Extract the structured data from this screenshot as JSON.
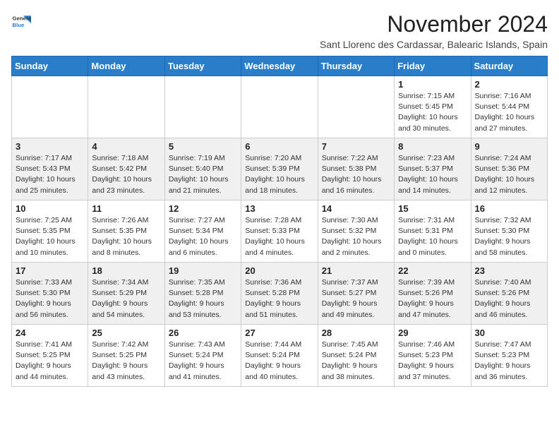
{
  "header": {
    "logo_line1": "General",
    "logo_line2": "Blue",
    "month": "November 2024",
    "location": "Sant Llorenc des Cardassar, Balearic Islands, Spain"
  },
  "days_of_week": [
    "Sunday",
    "Monday",
    "Tuesday",
    "Wednesday",
    "Thursday",
    "Friday",
    "Saturday"
  ],
  "weeks": [
    [
      {
        "num": "",
        "info": ""
      },
      {
        "num": "",
        "info": ""
      },
      {
        "num": "",
        "info": ""
      },
      {
        "num": "",
        "info": ""
      },
      {
        "num": "",
        "info": ""
      },
      {
        "num": "1",
        "info": "Sunrise: 7:15 AM\nSunset: 5:45 PM\nDaylight: 10 hours and 30 minutes."
      },
      {
        "num": "2",
        "info": "Sunrise: 7:16 AM\nSunset: 5:44 PM\nDaylight: 10 hours and 27 minutes."
      }
    ],
    [
      {
        "num": "3",
        "info": "Sunrise: 7:17 AM\nSunset: 5:43 PM\nDaylight: 10 hours and 25 minutes."
      },
      {
        "num": "4",
        "info": "Sunrise: 7:18 AM\nSunset: 5:42 PM\nDaylight: 10 hours and 23 minutes."
      },
      {
        "num": "5",
        "info": "Sunrise: 7:19 AM\nSunset: 5:40 PM\nDaylight: 10 hours and 21 minutes."
      },
      {
        "num": "6",
        "info": "Sunrise: 7:20 AM\nSunset: 5:39 PM\nDaylight: 10 hours and 18 minutes."
      },
      {
        "num": "7",
        "info": "Sunrise: 7:22 AM\nSunset: 5:38 PM\nDaylight: 10 hours and 16 minutes."
      },
      {
        "num": "8",
        "info": "Sunrise: 7:23 AM\nSunset: 5:37 PM\nDaylight: 10 hours and 14 minutes."
      },
      {
        "num": "9",
        "info": "Sunrise: 7:24 AM\nSunset: 5:36 PM\nDaylight: 10 hours and 12 minutes."
      }
    ],
    [
      {
        "num": "10",
        "info": "Sunrise: 7:25 AM\nSunset: 5:35 PM\nDaylight: 10 hours and 10 minutes."
      },
      {
        "num": "11",
        "info": "Sunrise: 7:26 AM\nSunset: 5:35 PM\nDaylight: 10 hours and 8 minutes."
      },
      {
        "num": "12",
        "info": "Sunrise: 7:27 AM\nSunset: 5:34 PM\nDaylight: 10 hours and 6 minutes."
      },
      {
        "num": "13",
        "info": "Sunrise: 7:28 AM\nSunset: 5:33 PM\nDaylight: 10 hours and 4 minutes."
      },
      {
        "num": "14",
        "info": "Sunrise: 7:30 AM\nSunset: 5:32 PM\nDaylight: 10 hours and 2 minutes."
      },
      {
        "num": "15",
        "info": "Sunrise: 7:31 AM\nSunset: 5:31 PM\nDaylight: 10 hours and 0 minutes."
      },
      {
        "num": "16",
        "info": "Sunrise: 7:32 AM\nSunset: 5:30 PM\nDaylight: 9 hours and 58 minutes."
      }
    ],
    [
      {
        "num": "17",
        "info": "Sunrise: 7:33 AM\nSunset: 5:30 PM\nDaylight: 9 hours and 56 minutes."
      },
      {
        "num": "18",
        "info": "Sunrise: 7:34 AM\nSunset: 5:29 PM\nDaylight: 9 hours and 54 minutes."
      },
      {
        "num": "19",
        "info": "Sunrise: 7:35 AM\nSunset: 5:28 PM\nDaylight: 9 hours and 53 minutes."
      },
      {
        "num": "20",
        "info": "Sunrise: 7:36 AM\nSunset: 5:28 PM\nDaylight: 9 hours and 51 minutes."
      },
      {
        "num": "21",
        "info": "Sunrise: 7:37 AM\nSunset: 5:27 PM\nDaylight: 9 hours and 49 minutes."
      },
      {
        "num": "22",
        "info": "Sunrise: 7:39 AM\nSunset: 5:26 PM\nDaylight: 9 hours and 47 minutes."
      },
      {
        "num": "23",
        "info": "Sunrise: 7:40 AM\nSunset: 5:26 PM\nDaylight: 9 hours and 46 minutes."
      }
    ],
    [
      {
        "num": "24",
        "info": "Sunrise: 7:41 AM\nSunset: 5:25 PM\nDaylight: 9 hours and 44 minutes."
      },
      {
        "num": "25",
        "info": "Sunrise: 7:42 AM\nSunset: 5:25 PM\nDaylight: 9 hours and 43 minutes."
      },
      {
        "num": "26",
        "info": "Sunrise: 7:43 AM\nSunset: 5:24 PM\nDaylight: 9 hours and 41 minutes."
      },
      {
        "num": "27",
        "info": "Sunrise: 7:44 AM\nSunset: 5:24 PM\nDaylight: 9 hours and 40 minutes."
      },
      {
        "num": "28",
        "info": "Sunrise: 7:45 AM\nSunset: 5:24 PM\nDaylight: 9 hours and 38 minutes."
      },
      {
        "num": "29",
        "info": "Sunrise: 7:46 AM\nSunset: 5:23 PM\nDaylight: 9 hours and 37 minutes."
      },
      {
        "num": "30",
        "info": "Sunrise: 7:47 AM\nSunset: 5:23 PM\nDaylight: 9 hours and 36 minutes."
      }
    ]
  ]
}
